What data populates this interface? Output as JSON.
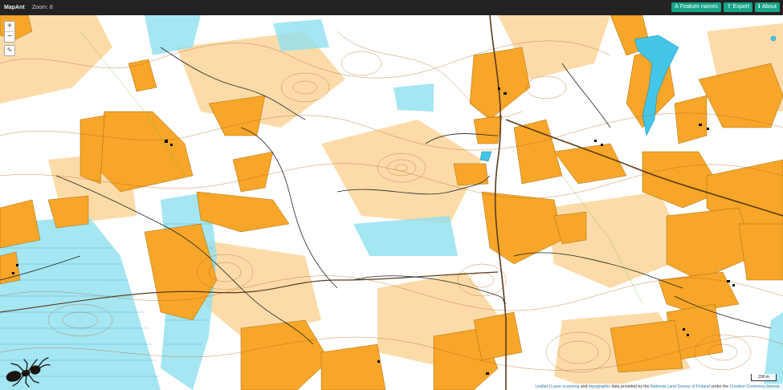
{
  "app": {
    "title": "MapAnt",
    "zoom_label": "Zoom:",
    "zoom_value": "8"
  },
  "toolbar": {
    "feature_names": "Feature names",
    "export": "Export",
    "about": "About"
  },
  "zoom_controls": {
    "plus": "+",
    "minus": "−",
    "draw_icon": "pencil-icon"
  },
  "scale": {
    "label": "200 m"
  },
  "attribution": {
    "leaflet": "Leaflet",
    "sep1": " | ",
    "laser": "Laser scanning",
    "and": " and ",
    "topo": "topographic",
    "mid": " data provided by the ",
    "nls": "National Land Survey of Finland",
    "under": " under the ",
    "license": "Creative Commons license",
    "end": "."
  },
  "colors": {
    "open_land": "#f7a629",
    "rough_open": "#fcd59a",
    "marsh": "#8fe0f0",
    "water": "#44c6e8",
    "contour": "#b5651d",
    "road": "#222222",
    "accent": "#17a589"
  }
}
